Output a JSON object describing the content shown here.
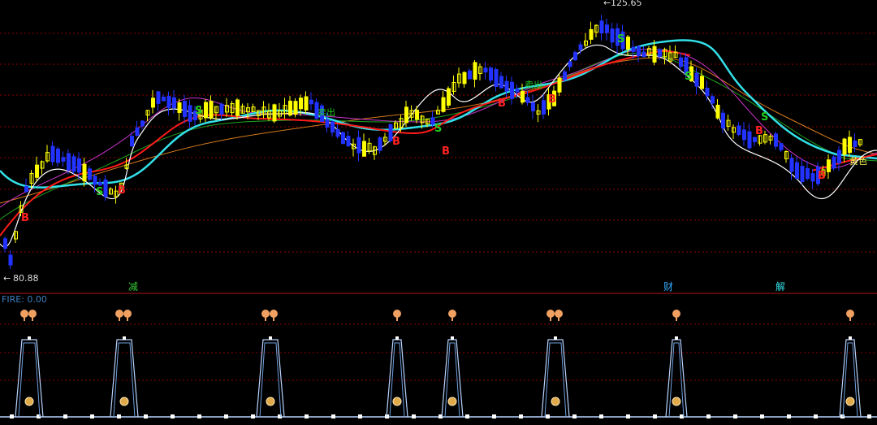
{
  "colors": {
    "background": "#000000",
    "grid": "#8b0000",
    "candle_up": "#ffff00",
    "candle_down": "#2233ff",
    "ma_white": "#ffffff",
    "ma_cyan": "#33e0e8",
    "ma_red": "#ff1a1a",
    "ma_magenta": "#cc33cc",
    "ma_green": "#1fa31f",
    "ma_orange": "#d47a1a",
    "buy": "#ff2222",
    "sell": "#22cc22",
    "fire_line": "#b8d4ff"
  },
  "chart_data": [
    {
      "type": "candlestick",
      "price_high_label": "125.65",
      "price_low_label": "80.88",
      "ylim": [
        78,
        128
      ],
      "markers_buy": [
        {
          "x": 31,
          "label": "B"
        },
        {
          "x": 150,
          "label": "B"
        },
        {
          "x": 488,
          "label": "B"
        },
        {
          "x": 549,
          "label": "B"
        },
        {
          "x": 618,
          "label": "B"
        },
        {
          "x": 680,
          "label": "B"
        },
        {
          "x": 935,
          "label": "B"
        },
        {
          "x": 1012,
          "label": "B"
        }
      ],
      "markers_sell": [
        {
          "x": 123,
          "label": "S"
        },
        {
          "x": 245,
          "label": "S"
        },
        {
          "x": 540,
          "label": "S"
        },
        {
          "x": 765,
          "label": "S"
        },
        {
          "x": 848,
          "label": "S"
        },
        {
          "x": 942,
          "label": "S"
        }
      ],
      "event_tags": [
        {
          "x": 165,
          "label": "减",
          "color": "#33cc33"
        },
        {
          "x": 824,
          "label": "财",
          "color": "#33aaff"
        },
        {
          "x": 962,
          "label": "解",
          "color": "#33e0e8"
        }
      ],
      "annotations": [
        {
          "x": 1060,
          "label": "黄色",
          "color": "#ffff55"
        },
        {
          "x": 405,
          "label": "卖出",
          "color": "#22cc22"
        },
        {
          "x": 660,
          "label": "卖出",
          "color": "#22cc22"
        }
      ]
    },
    {
      "type": "line",
      "title": "FIRE: 0.00",
      "spike_x": [
        36,
        153,
        333,
        489,
        557,
        684,
        833,
        1047
      ],
      "spike_kind": [
        "double",
        "double",
        "double",
        "single",
        "single",
        "double",
        "single",
        "single"
      ]
    }
  ]
}
